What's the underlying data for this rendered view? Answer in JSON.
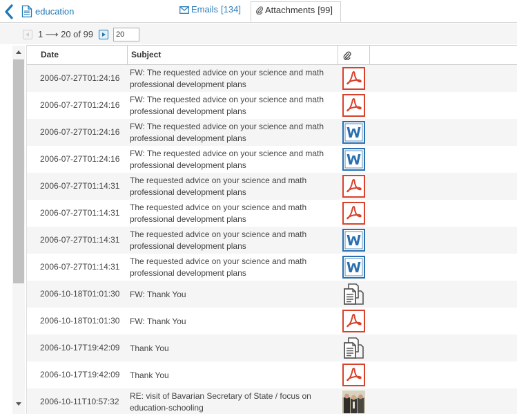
{
  "header": {
    "folder_name": "education"
  },
  "tabs": [
    {
      "label": "Emails",
      "count": "[134]",
      "active": false
    },
    {
      "label": "Attachments",
      "count": "[99]",
      "active": true
    }
  ],
  "pager": {
    "range_text": "1 ⟶ 20 of 99",
    "page_size": "20"
  },
  "columns": {
    "date": "Date",
    "subject": "Subject"
  },
  "rows": [
    {
      "date": "2006-07-27T01:24:16",
      "subject": "FW: The requested advice on your science and math professional development plans",
      "type": "pdf-icon"
    },
    {
      "date": "2006-07-27T01:24:16",
      "subject": "FW: The requested advice on your science and math professional development plans",
      "type": "pdf-icon"
    },
    {
      "date": "2006-07-27T01:24:16",
      "subject": "FW: The requested advice on your science and math professional development plans",
      "type": "word-icon"
    },
    {
      "date": "2006-07-27T01:24:16",
      "subject": "FW: The requested advice on your science and math professional development plans",
      "type": "word-icon"
    },
    {
      "date": "2006-07-27T01:14:31",
      "subject": "The requested advice on your science and math professional development plans",
      "type": "pdf-icon"
    },
    {
      "date": "2006-07-27T01:14:31",
      "subject": "The requested advice on your science and math professional development plans",
      "type": "pdf-icon"
    },
    {
      "date": "2006-07-27T01:14:31",
      "subject": "The requested advice on your science and math professional development plans",
      "type": "word-icon"
    },
    {
      "date": "2006-07-27T01:14:31",
      "subject": "The requested advice on your science and math professional development plans",
      "type": "word-icon"
    },
    {
      "date": "2006-10-18T01:01:30",
      "subject": "FW: Thank You",
      "type": "document-icon"
    },
    {
      "date": "2006-10-18T01:01:30",
      "subject": "FW: Thank You",
      "type": "pdf-icon"
    },
    {
      "date": "2006-10-17T19:42:09",
      "subject": "Thank You",
      "type": "document-icon"
    },
    {
      "date": "2006-10-17T19:42:09",
      "subject": "Thank You",
      "type": "pdf-icon"
    },
    {
      "date": "2006-10-11T10:57:32",
      "subject": "RE: visit of Bavarian Secretary of State / focus on education-schooling",
      "type": "photo-thumbnail"
    }
  ],
  "colors": {
    "link_blue": "#1f78b4",
    "pdf_red": "#d9412b",
    "word_blue": "#2a6fb0",
    "doc_dark": "#555555"
  }
}
